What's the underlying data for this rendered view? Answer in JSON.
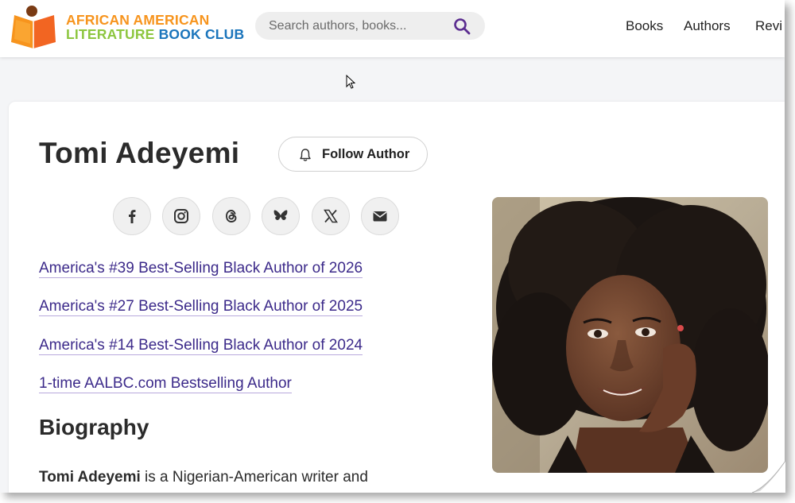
{
  "site": {
    "logo_line1": "AFRICAN AMERICAN",
    "logo_line2a": "LITERATURE ",
    "logo_line2b": "BOOK CLUB"
  },
  "search": {
    "placeholder": "Search authors, books..."
  },
  "nav": {
    "items": [
      "Books",
      "Authors",
      "Revi"
    ]
  },
  "author": {
    "name": "Tomi Adeyemi",
    "follow_label": "Follow Author",
    "photo_alt": "Tomi Adeyemi"
  },
  "social": [
    "facebook-icon",
    "instagram-icon",
    "threads-icon",
    "bluesky-icon",
    "x-icon",
    "email-icon"
  ],
  "ranks": [
    "America's #39 Best-Selling Black Author of 2026",
    "America's #27 Best-Selling Black Author of 2025",
    "America's #14 Best-Selling Black Author of 2024",
    "1-time AALBC.com Bestselling Author"
  ],
  "biography": {
    "heading": "Biography",
    "name_bold": "Tomi Adeyemi",
    "text": " is a Nigerian-American writer and"
  },
  "colors": {
    "link": "#3c2a8a",
    "accent_orange": "#f7941d",
    "accent_green": "#8dc63f",
    "accent_blue": "#1b75bc",
    "search_icon": "#5b2d90"
  }
}
